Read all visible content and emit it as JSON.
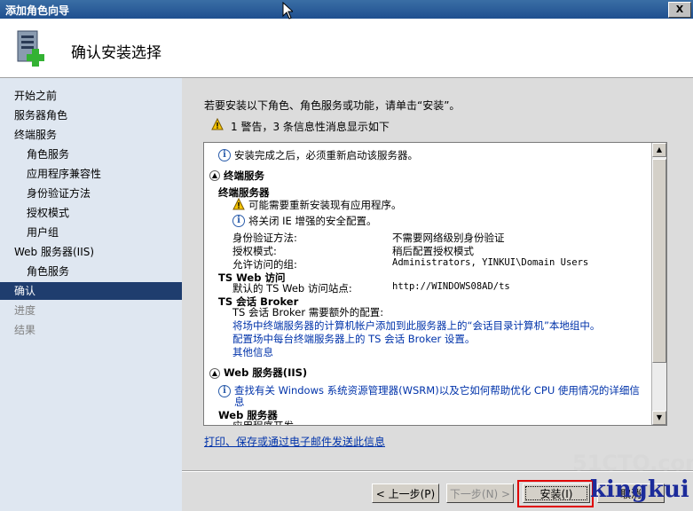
{
  "window": {
    "title": "添加角色向导",
    "close_label": "X"
  },
  "header": {
    "heading": "确认安装选择"
  },
  "nav": {
    "items": [
      {
        "label": "开始之前"
      },
      {
        "label": "服务器角色"
      },
      {
        "label": "终端服务"
      },
      {
        "label": "角色服务"
      },
      {
        "label": "应用程序兼容性"
      },
      {
        "label": "身份验证方法"
      },
      {
        "label": "授权模式"
      },
      {
        "label": "用户组"
      },
      {
        "label": "Web 服务器(IIS)"
      },
      {
        "label": "角色服务"
      },
      {
        "label": "确认"
      },
      {
        "label": "进度"
      },
      {
        "label": "结果"
      }
    ]
  },
  "main": {
    "intro": "若要安装以下角色、角色服务或功能，请单击“安装”。",
    "warning_summary": "1 警告，3 条信息性消息显示如下",
    "info_restart": "安装完成之后，必须重新启动该服务器。",
    "ts_section": "终端服务",
    "ts_server_title": "终端服务器",
    "ts_warn": "可能需要重新安装现有应用程序。",
    "ts_info_ie": "将关闭 IE 增强的安全配置。",
    "auth_label": "身份验证方法:",
    "auth_value": "不需要网络级别身份验证",
    "license_label": "授权模式:",
    "license_value": "稍后配置授权模式",
    "groups_label": "允许访问的组:",
    "groups_value": "Administrators, YINKUI\\Domain Users",
    "tsweb_title": "TS Web 访问",
    "tsweb_site_label": "默认的 TS Web 访问站点:",
    "tsweb_site_value": "http://WINDOWS08AD/ts",
    "broker_title": "TS 会话 Broker",
    "broker_note": "TS 会话 Broker 需要额外的配置:",
    "broker_link1": "将场中终端服务器的计算机帐户添加到此服务器上的“会话目录计算机”本地组中。",
    "broker_link2": "配置场中每台终端服务器上的 TS 会话 Broker 设置。",
    "broker_link3": "其他信息",
    "iis_section": "Web 服务器(IIS)",
    "iis_info": "查找有关 Windows 系统资源管理器(WSRM)以及它如何帮助优化 CPU 使用情况的详细信",
    "iis_info_2": "息",
    "iis_server_title": "Web 服务器",
    "iis_cut": "应用程序开发",
    "print_link": "打印、保存或通过电子邮件发送此信息"
  },
  "buttons": {
    "prev": "< 上一步(P)",
    "next": "下一步(N) >",
    "install": "安装(I)",
    "cancel": "取消"
  },
  "watermark": {
    "site": "51CTO.com",
    "author": "kingkui"
  },
  "colors": {
    "nav_active": "#1f3d6e",
    "link": "#0033aa",
    "highlight_box": "#e00000"
  }
}
